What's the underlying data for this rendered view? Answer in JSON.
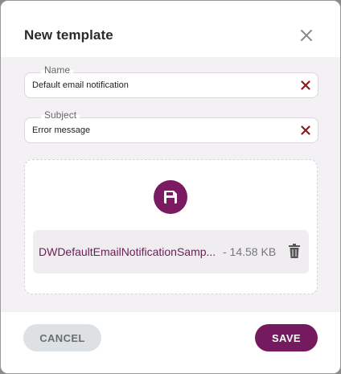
{
  "dialog": {
    "title": "New template"
  },
  "form": {
    "name": {
      "label": "Name",
      "value": "Default email notification"
    },
    "subject": {
      "label": "Subject",
      "value": "Error message"
    }
  },
  "upload": {
    "icon": "save-icon",
    "file_name": "DWDefaultEmailNotificationSamp...",
    "file_size": "- 14.58 KB"
  },
  "footer": {
    "cancel_label": "CANCEL",
    "save_label": "SAVE"
  },
  "colors": {
    "accent": "#751a5e",
    "clear_icon": "#8b1a1a",
    "body_bg": "#f3f1f4"
  }
}
